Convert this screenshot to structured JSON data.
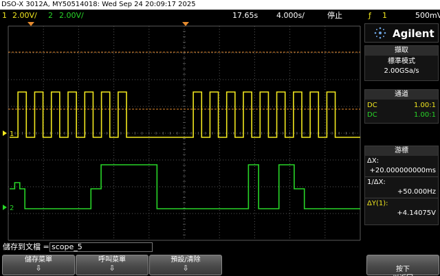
{
  "title_bar": {
    "text": "DSO-X 3012A, MY50514018: Wed Sep 24 20:09:17 2025"
  },
  "status_bar": {
    "ch1_label": "1",
    "ch1_scale": "2.00V/",
    "ch2_label": "2",
    "ch2_scale": "2.00V/",
    "delay": "17.65s",
    "timebase": "4.000s/",
    "run_state": "停止",
    "trigger_icon": "trigger-edge-icon",
    "trigger_glyph": "ƒ",
    "trigger_source": "1",
    "trigger_level": "500mV"
  },
  "sidebar": {
    "brand": "Agilent",
    "acquire": {
      "header": "擷取",
      "mode": "標準模式",
      "rate": "2.00GSa/s"
    },
    "channels": {
      "header": "通道",
      "rows": [
        {
          "coupling": "DC",
          "probe": "1.00:1"
        },
        {
          "coupling": "DC",
          "probe": "1.00:1"
        }
      ]
    },
    "cursors": {
      "header": "游標",
      "dx_label": "ΔX:",
      "dx_value": "+20.000000000ms",
      "inv_dx_label": "1/ΔX:",
      "inv_dx_value": "+50.000Hz",
      "dy_label": "ΔY(1):",
      "dy_value": "+4.14075V"
    }
  },
  "waveform": {
    "ch1_color": "#f2e81f",
    "ch2_color": "#28d628",
    "grid_color": "#5a5a5a",
    "cursor_color": "#e58a2e",
    "ch1_marker": "1",
    "ch2_marker": "2",
    "ch1_bits": [
      0,
      1,
      0,
      1,
      0,
      1,
      0,
      1,
      0,
      1,
      0,
      1,
      0,
      1,
      0,
      0,
      0,
      0,
      0,
      0,
      0,
      0,
      1,
      0,
      1,
      0,
      1,
      0,
      1,
      0,
      1,
      0,
      1,
      0,
      1,
      0,
      1,
      0,
      1,
      0,
      0,
      0
    ],
    "ch2_levels": [
      2,
      3,
      2,
      1,
      1,
      1,
      1,
      1,
      1,
      1,
      1,
      1,
      1,
      1,
      1,
      1,
      2,
      2,
      4,
      4,
      4,
      4,
      4,
      4,
      4,
      4,
      4,
      4,
      4,
      1,
      1,
      1,
      1,
      1,
      1,
      1,
      1,
      1,
      1,
      1,
      1,
      1,
      1,
      1,
      1,
      1,
      1,
      4,
      4,
      1,
      1,
      1,
      1,
      4,
      4,
      4,
      2,
      2,
      1,
      1,
      1,
      1,
      1,
      1,
      1,
      1,
      1,
      1,
      1
    ]
  },
  "save_bar": {
    "label": "儲存到文檔 =",
    "filename": "scope_5"
  },
  "softkeys": [
    {
      "label": "儲存菜單",
      "arrow": "⇩"
    },
    {
      "label": "呼叫菜單",
      "arrow": "⇩"
    },
    {
      "label": "預設/清除",
      "arrow": "⇩"
    },
    {
      "label": "按下\n以返回",
      "arrow": ""
    }
  ]
}
